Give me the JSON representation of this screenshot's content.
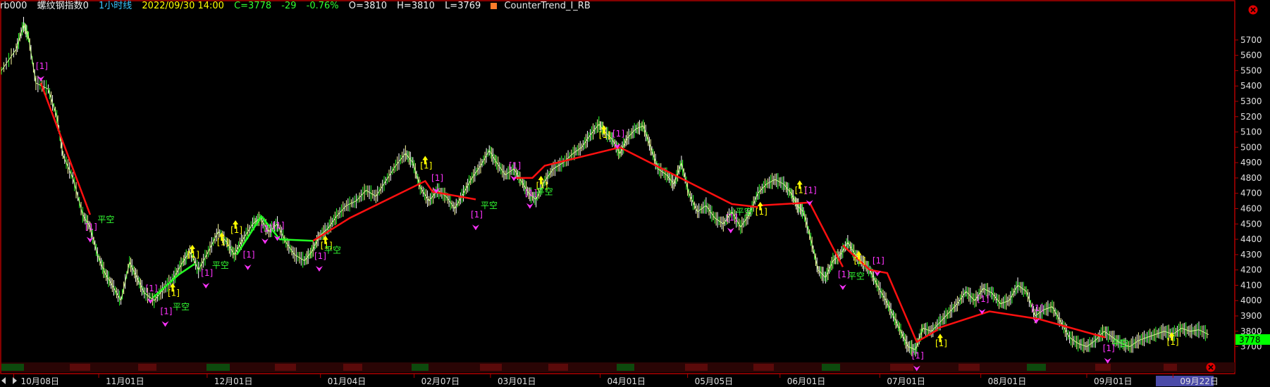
{
  "header": {
    "symbol": "rb000",
    "name": "螺纹钢指数0",
    "period": "1小时线",
    "datetime": "2022/09/30 14:00",
    "close": "C=3778",
    "change": "-29",
    "change_pct": "-0.76%",
    "open": "O=3810",
    "high": "H=3810",
    "low": "L=3769",
    "indicator": "CounterTrend_I_RB"
  },
  "price_tag": "3778",
  "highlight_date": "09月22日",
  "colors": {
    "background": "#000000",
    "frame": "#b00000",
    "price_tag": "#00ff00",
    "trend_line": "#ff0000"
  },
  "icons": [
    "close-circle-icon",
    "close-circle-icon",
    "scroll-left-icon",
    "scroll-right-icon"
  ],
  "chart_data": {
    "type": "line",
    "ylim": [
      3620,
      5860
    ],
    "y_ticks": [
      "5700",
      "5600",
      "5500",
      "5400",
      "5300",
      "5200",
      "5100",
      "5000",
      "4900",
      "4800",
      "4700",
      "4600",
      "4500",
      "4400",
      "4300",
      "4200",
      "4100",
      "4000",
      "3900",
      "3800",
      "3700"
    ],
    "x_ticks": [
      {
        "i": 0.01,
        "label": "10月08日"
      },
      {
        "i": 0.079,
        "label": "11月01日"
      },
      {
        "i": 0.167,
        "label": "12月01日"
      },
      {
        "i": 0.259,
        "label": "01月04日"
      },
      {
        "i": 0.335,
        "label": "02月07日"
      },
      {
        "i": 0.397,
        "label": "03月01日"
      },
      {
        "i": 0.486,
        "label": "04月01日"
      },
      {
        "i": 0.557,
        "label": "05月05日"
      },
      {
        "i": 0.632,
        "label": "06月01日"
      },
      {
        "i": 0.713,
        "label": "07月01日"
      },
      {
        "i": 0.795,
        "label": "08月01日"
      },
      {
        "i": 0.881,
        "label": "09月01日"
      },
      {
        "i": 0.951,
        "label": "09月22日"
      }
    ],
    "series": [
      {
        "values": [
          [
            0.0,
            5500
          ],
          [
            0.012,
            5640
          ],
          [
            0.018,
            5800
          ],
          [
            0.022,
            5720
          ],
          [
            0.028,
            5420
          ],
          [
            0.038,
            5380
          ],
          [
            0.045,
            5200
          ],
          [
            0.05,
            4950
          ],
          [
            0.058,
            4800
          ],
          [
            0.066,
            4560
          ],
          [
            0.072,
            4480
          ],
          [
            0.078,
            4300
          ],
          [
            0.084,
            4180
          ],
          [
            0.09,
            4100
          ],
          [
            0.097,
            4000
          ],
          [
            0.104,
            4250
          ],
          [
            0.11,
            4150
          ],
          [
            0.116,
            4050
          ],
          [
            0.124,
            4000
          ],
          [
            0.132,
            4080
          ],
          [
            0.14,
            4150
          ],
          [
            0.147,
            4250
          ],
          [
            0.153,
            4320
          ],
          [
            0.16,
            4200
          ],
          [
            0.168,
            4320
          ],
          [
            0.176,
            4450
          ],
          [
            0.183,
            4380
          ],
          [
            0.189,
            4300
          ],
          [
            0.196,
            4400
          ],
          [
            0.204,
            4500
          ],
          [
            0.21,
            4540
          ],
          [
            0.217,
            4450
          ],
          [
            0.224,
            4500
          ],
          [
            0.231,
            4380
          ],
          [
            0.238,
            4300
          ],
          [
            0.246,
            4260
          ],
          [
            0.252,
            4320
          ],
          [
            0.258,
            4420
          ],
          [
            0.265,
            4470
          ],
          [
            0.272,
            4550
          ],
          [
            0.28,
            4620
          ],
          [
            0.288,
            4650
          ],
          [
            0.296,
            4720
          ],
          [
            0.304,
            4680
          ],
          [
            0.312,
            4780
          ],
          [
            0.32,
            4880
          ],
          [
            0.328,
            4960
          ],
          [
            0.334,
            4900
          ],
          [
            0.34,
            4740
          ],
          [
            0.347,
            4650
          ],
          [
            0.354,
            4720
          ],
          [
            0.361,
            4680
          ],
          [
            0.368,
            4600
          ],
          [
            0.375,
            4700
          ],
          [
            0.382,
            4800
          ],
          [
            0.389,
            4880
          ],
          [
            0.396,
            4980
          ],
          [
            0.402,
            4900
          ],
          [
            0.409,
            4820
          ],
          [
            0.416,
            4860
          ],
          [
            0.422,
            4780
          ],
          [
            0.428,
            4700
          ],
          [
            0.434,
            4660
          ],
          [
            0.441,
            4780
          ],
          [
            0.448,
            4860
          ],
          [
            0.456,
            4900
          ],
          [
            0.464,
            4960
          ],
          [
            0.471,
            5000
          ],
          [
            0.478,
            5080
          ],
          [
            0.485,
            5150
          ],
          [
            0.49,
            5100
          ],
          [
            0.496,
            5050
          ],
          [
            0.502,
            4960
          ],
          [
            0.508,
            5060
          ],
          [
            0.515,
            5120
          ],
          [
            0.521,
            5140
          ],
          [
            0.527,
            5000
          ],
          [
            0.533,
            4860
          ],
          [
            0.54,
            4820
          ],
          [
            0.546,
            4760
          ],
          [
            0.552,
            4900
          ],
          [
            0.558,
            4700
          ],
          [
            0.565,
            4580
          ],
          [
            0.572,
            4620
          ],
          [
            0.579,
            4540
          ],
          [
            0.586,
            4500
          ],
          [
            0.593,
            4580
          ],
          [
            0.6,
            4480
          ],
          [
            0.607,
            4560
          ],
          [
            0.614,
            4700
          ],
          [
            0.621,
            4760
          ],
          [
            0.628,
            4790
          ],
          [
            0.635,
            4760
          ],
          [
            0.641,
            4700
          ],
          [
            0.646,
            4620
          ],
          [
            0.651,
            4580
          ],
          [
            0.657,
            4400
          ],
          [
            0.663,
            4200
          ],
          [
            0.669,
            4150
          ],
          [
            0.675,
            4260
          ],
          [
            0.681,
            4300
          ],
          [
            0.687,
            4380
          ],
          [
            0.693,
            4300
          ],
          [
            0.699,
            4250
          ],
          [
            0.705,
            4200
          ],
          [
            0.711,
            4100
          ],
          [
            0.718,
            4000
          ],
          [
            0.724,
            3900
          ],
          [
            0.73,
            3800
          ],
          [
            0.736,
            3700
          ],
          [
            0.742,
            3680
          ],
          [
            0.748,
            3820
          ],
          [
            0.755,
            3800
          ],
          [
            0.762,
            3860
          ],
          [
            0.769,
            3920
          ],
          [
            0.776,
            3980
          ],
          [
            0.783,
            4060
          ],
          [
            0.79,
            4000
          ],
          [
            0.797,
            4080
          ],
          [
            0.804,
            4050
          ],
          [
            0.811,
            3980
          ],
          [
            0.818,
            4000
          ],
          [
            0.825,
            4100
          ],
          [
            0.832,
            4060
          ],
          [
            0.839,
            3900
          ],
          [
            0.846,
            3940
          ],
          [
            0.853,
            3960
          ],
          [
            0.86,
            3860
          ],
          [
            0.867,
            3760
          ],
          [
            0.874,
            3720
          ],
          [
            0.881,
            3700
          ],
          [
            0.888,
            3740
          ],
          [
            0.895,
            3800
          ],
          [
            0.902,
            3760
          ],
          [
            0.909,
            3720
          ],
          [
            0.916,
            3700
          ],
          [
            0.923,
            3740
          ],
          [
            0.93,
            3760
          ],
          [
            0.937,
            3780
          ],
          [
            0.944,
            3800
          ],
          [
            0.951,
            3780
          ],
          [
            0.958,
            3820
          ],
          [
            0.965,
            3800
          ],
          [
            0.972,
            3810
          ],
          [
            0.98,
            3778
          ]
        ]
      }
    ],
    "trend_lines": [
      [
        [
          0.032,
          5420
        ],
        [
          0.072,
          4560
        ]
      ],
      [
        [
          0.123,
          4020
        ],
        [
          0.144,
          4170
        ],
        [
          0.157,
          4240
        ]
      ],
      [
        [
          0.191,
          4300
        ],
        [
          0.211,
          4550
        ],
        [
          0.226,
          4400
        ],
        [
          0.253,
          4390
        ]
      ],
      [
        [
          0.253,
          4390
        ],
        [
          0.283,
          4540
        ],
        [
          0.344,
          4780
        ],
        [
          0.35,
          4710
        ],
        [
          0.385,
          4660
        ]
      ],
      [
        [
          0.416,
          4800
        ],
        [
          0.431,
          4800
        ],
        [
          0.441,
          4880
        ],
        [
          0.492,
          4980
        ],
        [
          0.502,
          5000
        ],
        [
          0.593,
          4630
        ],
        [
          0.614,
          4610
        ]
      ],
      [
        [
          0.614,
          4620
        ],
        [
          0.656,
          4640
        ],
        [
          0.683,
          4220
        ]
      ],
      [
        [
          0.683,
          4360
        ],
        [
          0.705,
          4200
        ],
        [
          0.719,
          4180
        ],
        [
          0.743,
          3730
        ],
        [
          0.76,
          3810
        ]
      ],
      [
        [
          0.76,
          3820
        ],
        [
          0.802,
          3930
        ],
        [
          0.842,
          3880
        ],
        [
          0.896,
          3760
        ]
      ]
    ],
    "signals": [
      {
        "i": 0.032,
        "y": 5530,
        "label": "[1]",
        "color": "#ff33ff",
        "kind": "down"
      },
      {
        "i": 0.072,
        "y": 4480,
        "label": "[1]",
        "color": "#ff33ff",
        "kind": "down"
      },
      {
        "i": 0.082,
        "y": 4530,
        "label": "平空",
        "color": "#33ff33",
        "kind": "text"
      },
      {
        "i": 0.121,
        "y": 4080,
        "label": "[1]",
        "color": "#ff33ff",
        "kind": "down"
      },
      {
        "i": 0.139,
        "y": 4050,
        "label": "[1]",
        "color": "#ffff00",
        "kind": "up"
      },
      {
        "i": 0.133,
        "y": 3930,
        "label": "[1]",
        "color": "#ff33ff",
        "kind": "down"
      },
      {
        "i": 0.143,
        "y": 3960,
        "label": "平空",
        "color": "#33ff33",
        "kind": "text"
      },
      {
        "i": 0.155,
        "y": 4300,
        "label": "[1]",
        "color": "#ffff00",
        "kind": "up"
      },
      {
        "i": 0.166,
        "y": 4180,
        "label": "[1]",
        "color": "#ff33ff",
        "kind": "down"
      },
      {
        "i": 0.175,
        "y": 4230,
        "label": "平空",
        "color": "#33ff33",
        "kind": "text"
      },
      {
        "i": 0.179,
        "y": 4380,
        "label": "[1]",
        "color": "#ffff00",
        "kind": "up"
      },
      {
        "i": 0.19,
        "y": 4460,
        "label": "[1]",
        "color": "#ffff00",
        "kind": "up"
      },
      {
        "i": 0.2,
        "y": 4300,
        "label": "[1]",
        "color": "#ff33ff",
        "kind": "down"
      },
      {
        "i": 0.214,
        "y": 4470,
        "label": "[1]",
        "color": "#ff33ff",
        "kind": "down"
      },
      {
        "i": 0.224,
        "y": 4490,
        "label": "[1]",
        "color": "#ff33ff",
        "kind": "down"
      },
      {
        "i": 0.258,
        "y": 4290,
        "label": "[1]",
        "color": "#ff33ff",
        "kind": "down"
      },
      {
        "i": 0.263,
        "y": 4360,
        "label": "[1]",
        "color": "#ffff00",
        "kind": "up"
      },
      {
        "i": 0.266,
        "y": 4330,
        "label": "平空",
        "color": "#33ff33",
        "kind": "text"
      },
      {
        "i": 0.344,
        "y": 4880,
        "label": "[1]",
        "color": "#ffff00",
        "kind": "up"
      },
      {
        "i": 0.353,
        "y": 4800,
        "label": "[1]",
        "color": "#ff33ff",
        "kind": "down"
      },
      {
        "i": 0.385,
        "y": 4560,
        "label": "[1]",
        "color": "#ff33ff",
        "kind": "down"
      },
      {
        "i": 0.393,
        "y": 4620,
        "label": "平空",
        "color": "#33ff33",
        "kind": "text"
      },
      {
        "i": 0.416,
        "y": 4880,
        "label": "[1]",
        "color": "#ff33ff",
        "kind": "down"
      },
      {
        "i": 0.429,
        "y": 4700,
        "label": "[1]",
        "color": "#ff33ff",
        "kind": "down"
      },
      {
        "i": 0.438,
        "y": 4750,
        "label": "[1]",
        "color": "#ffff00",
        "kind": "up"
      },
      {
        "i": 0.438,
        "y": 4710,
        "label": "平空",
        "color": "#33ff33",
        "kind": "text"
      },
      {
        "i": 0.489,
        "y": 5080,
        "label": "[1]",
        "color": "#ffff00",
        "kind": "up"
      },
      {
        "i": 0.5,
        "y": 5090,
        "label": "[1]",
        "color": "#ff33ff",
        "kind": "down"
      },
      {
        "i": 0.592,
        "y": 4540,
        "label": "[1]",
        "color": "#ff33ff",
        "kind": "down"
      },
      {
        "i": 0.6,
        "y": 4580,
        "label": "平空",
        "color": "#33ff33",
        "kind": "text"
      },
      {
        "i": 0.616,
        "y": 4580,
        "label": "[1]",
        "color": "#ffff00",
        "kind": "up"
      },
      {
        "i": 0.648,
        "y": 4720,
        "label": "[1]",
        "color": "#ffff00",
        "kind": "up"
      },
      {
        "i": 0.656,
        "y": 4720,
        "label": "[1]",
        "color": "#ff33ff",
        "kind": "down"
      },
      {
        "i": 0.683,
        "y": 4170,
        "label": "[1]",
        "color": "#ff33ff",
        "kind": "down"
      },
      {
        "i": 0.691,
        "y": 4160,
        "label": "平空",
        "color": "#33ff33",
        "kind": "text"
      },
      {
        "i": 0.696,
        "y": 4260,
        "label": "[1]",
        "color": "#ffff00",
        "kind": "up"
      },
      {
        "i": 0.711,
        "y": 4260,
        "label": "[1]",
        "color": "#ff33ff",
        "kind": "down"
      },
      {
        "i": 0.743,
        "y": 3640,
        "label": "[1]",
        "color": "#ff33ff",
        "kind": "down"
      },
      {
        "i": 0.762,
        "y": 3720,
        "label": "[1]",
        "color": "#ffff00",
        "kind": "up"
      },
      {
        "i": 0.796,
        "y": 4010,
        "label": "[1]",
        "color": "#ff33ff",
        "kind": "down"
      },
      {
        "i": 0.84,
        "y": 3950,
        "label": "[1]",
        "color": "#ff33ff",
        "kind": "down"
      },
      {
        "i": 0.898,
        "y": 3690,
        "label": "[1]",
        "color": "#ff33ff",
        "kind": "down"
      },
      {
        "i": 0.905,
        "y": 3720,
        "label": "平空",
        "color": "#33ff33",
        "kind": "text"
      },
      {
        "i": 0.95,
        "y": 3730,
        "label": "[1]",
        "color": "#ffff00",
        "kind": "up"
      }
    ]
  }
}
